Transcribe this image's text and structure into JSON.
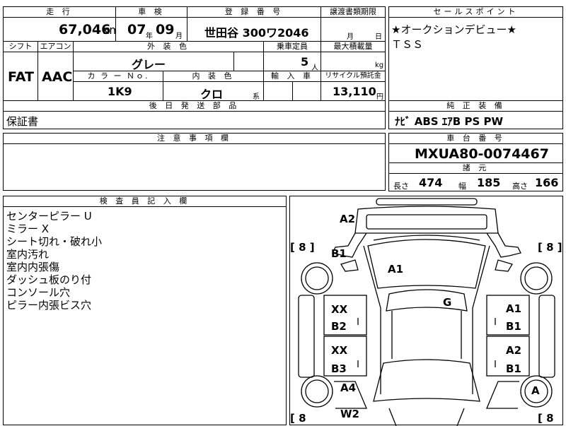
{
  "top": {
    "mileage_label": "走 行",
    "mileage_value": "67,046",
    "mileage_unit": "km",
    "inspection_label": "車 検",
    "inspection_year": "07",
    "year_unit": "年",
    "inspection_month": "09",
    "month_unit": "月",
    "reg_label": "登 録 番 号",
    "reg_value": "世田谷 300ワ2046",
    "transfer_label": "譲渡書類期限",
    "transfer_month": "月",
    "transfer_day": "日",
    "sales_label": "セールスポイント",
    "sales_line1": "★オークションデビュー★",
    "sales_line2": "ＴＳＳ"
  },
  "row2": {
    "shift_label": "シフト",
    "shift_value": "FAT",
    "ac_label": "エアコン",
    "ac_value": "AAC",
    "exterior_label": "外 装 色",
    "exterior_value": "グレー",
    "capacity_label": "乗車定員",
    "capacity_value": "5",
    "capacity_unit": "人",
    "load_label": "最大積載量",
    "load_unit": "kg",
    "color_no_label": "カ ラ ー Ｎｏ.",
    "color_no_value": "1K9",
    "interior_label": "内 装 色",
    "interior_value": "クロ",
    "interior_unit": "系",
    "import_label": "輸 入 車",
    "recycle_label": "リサイクル預託金",
    "recycle_value": "13,110",
    "recycle_unit": "円"
  },
  "parts": {
    "label": "後 日 発 送 部 品",
    "value": "保証書"
  },
  "equipment": {
    "label": "純 正 装 備",
    "value": "ﾅﾋﾞ ABS ｴｱB PS PW"
  },
  "notes": {
    "label": "注 意 事 項 欄"
  },
  "chassis": {
    "label": "車 台 番 号",
    "value": "MXUA80-0074467",
    "spec_label": "諸 元",
    "length_label": "長さ",
    "length_value": "474",
    "width_label": "幅",
    "width_value": "185",
    "height_label": "高さ",
    "height_value": "166"
  },
  "inspector": {
    "label": "検 査 員 記 入 欄",
    "lines": [
      "センターピラー U",
      "ミラー X",
      "シート切れ・破れ小",
      "室内汚れ",
      "室内内張傷",
      "ダッシュ板のり付",
      "コンソール穴",
      "ピラー内張ビス穴"
    ]
  },
  "diagram": {
    "marks": {
      "a2_top": "A2",
      "b1_left": "B1",
      "a1_center": "A1",
      "g": "G",
      "xx_1": "XX",
      "b2_left": "B2",
      "xx_2": "XX",
      "b3_left": "B3",
      "a4": "A4",
      "w2": "W2",
      "a1_right": "A1",
      "b1_right_1": "B1",
      "a2_right": "A2",
      "b1_right_2": "B1",
      "a_wheel": "A"
    },
    "tires": {
      "front_left": "[ 8 ]",
      "front_right": "[ 8 ]",
      "rear_left": "[ 8",
      "rear_right": "[ 8"
    }
  }
}
